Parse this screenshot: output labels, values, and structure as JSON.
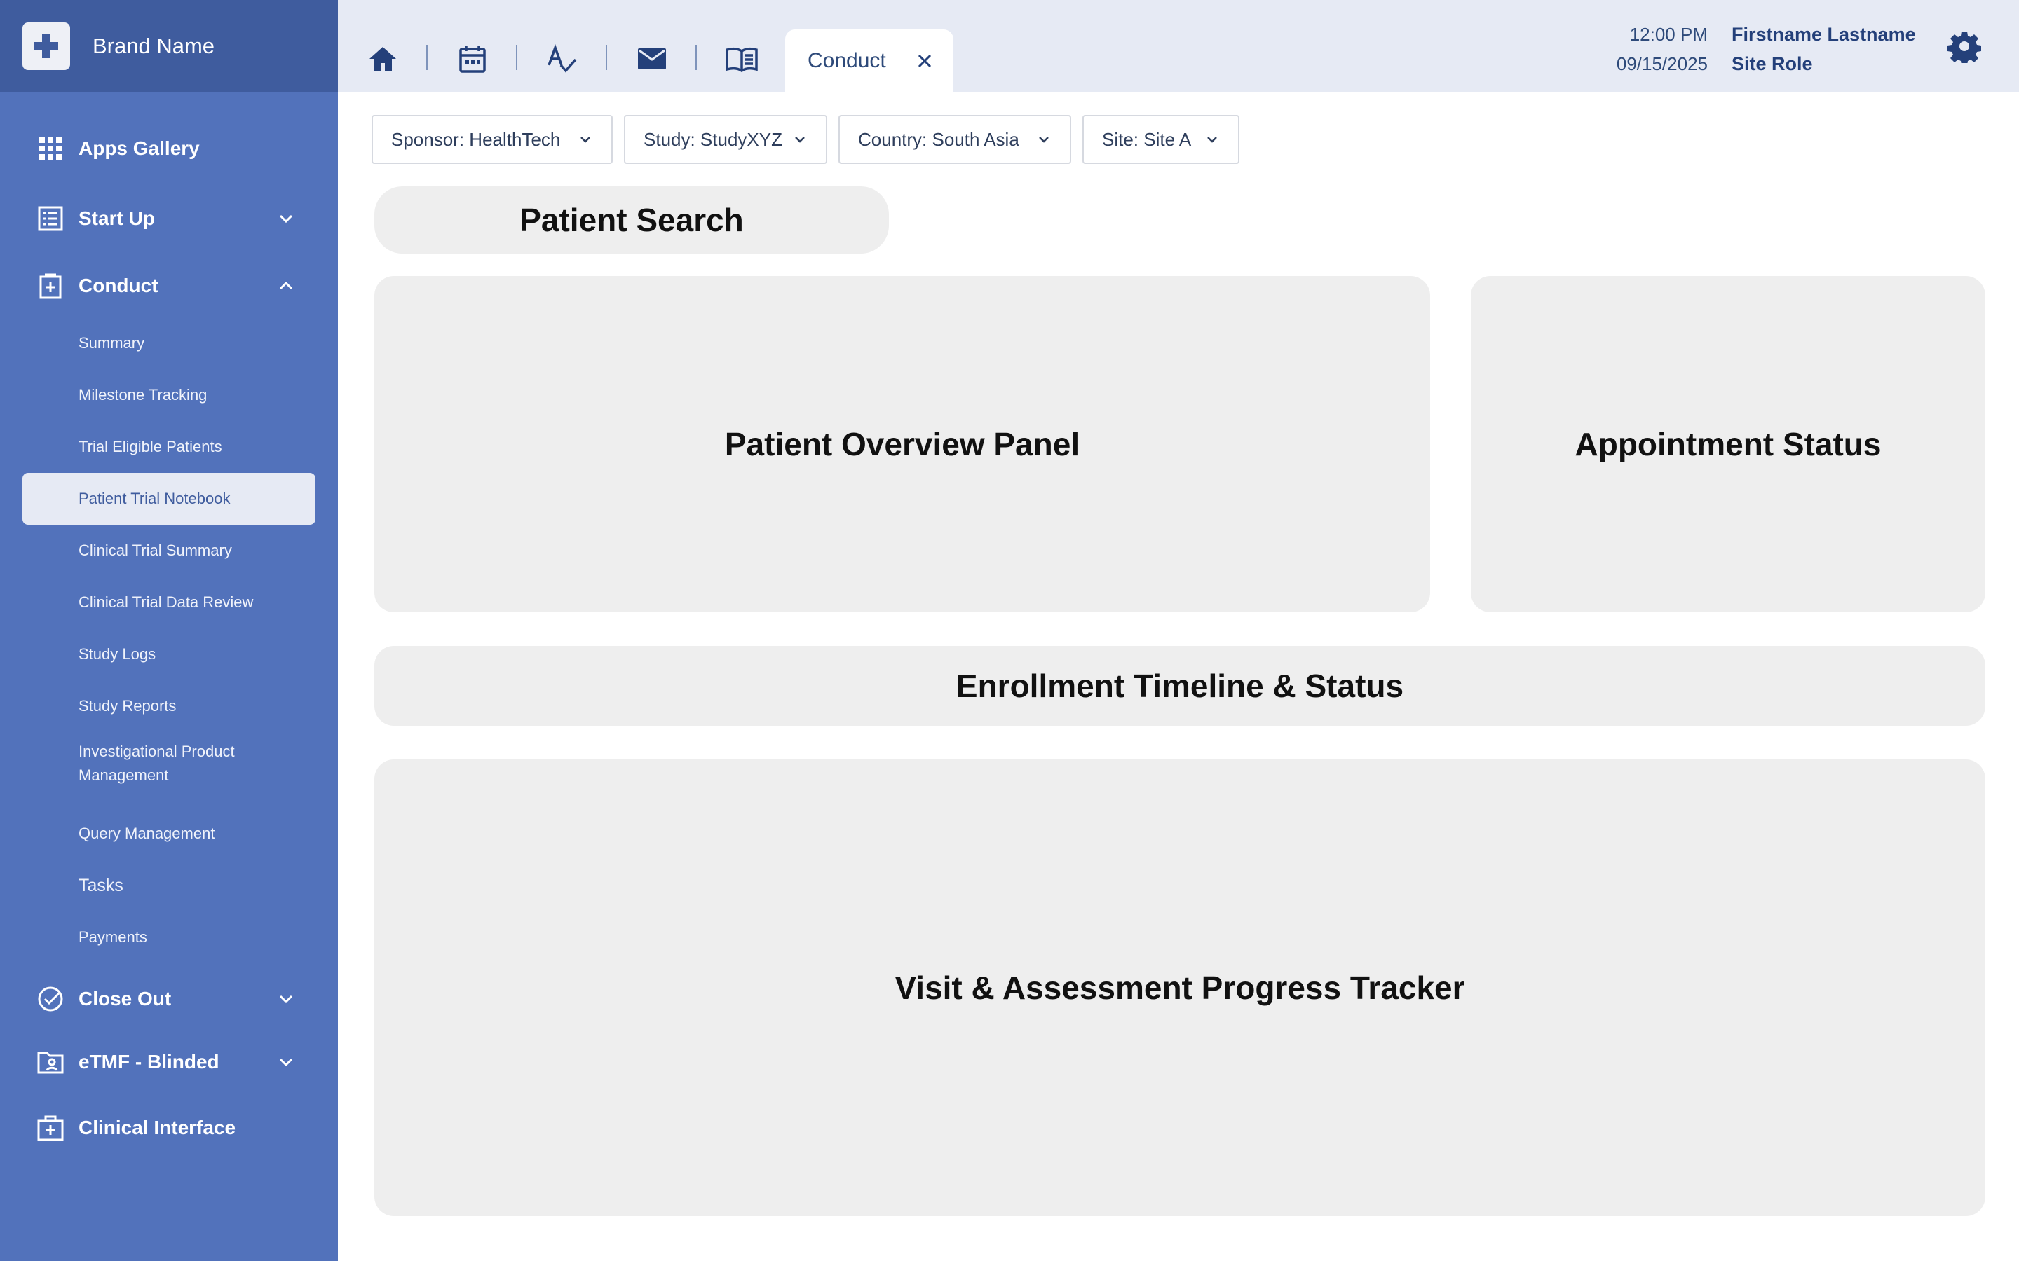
{
  "brand": {
    "name": "Brand Name",
    "icon": "medical-cross-icon"
  },
  "sidebar": {
    "items": [
      {
        "label": "Apps Gallery",
        "icon": "grid-icon"
      },
      {
        "label": "Start Up",
        "icon": "checklist-icon",
        "expanded": false
      },
      {
        "label": "Conduct",
        "icon": "clipboard-plus-icon",
        "expanded": true
      },
      {
        "label": "Close Out",
        "icon": "check-circle-icon",
        "expanded": false
      },
      {
        "label": "eTMF - Blinded",
        "icon": "folder-user-icon",
        "expanded": false
      },
      {
        "label": "Clinical Interface",
        "icon": "medical-bag-icon"
      }
    ],
    "conduct_sub": [
      "Summary",
      "Milestone Tracking",
      "Trial Eligible Patients",
      "Patient Trial Notebook",
      "Clinical Trial Summary",
      "Clinical Trial Data Review",
      "Study Logs",
      "Study Reports",
      "Investigational Product Management",
      "Query Management",
      "Tasks",
      "Payments"
    ],
    "active_sub": "Patient Trial Notebook"
  },
  "topbar": {
    "icons": [
      "home-icon",
      "calendar-icon",
      "spellcheck-icon",
      "mail-icon",
      "book-icon"
    ],
    "tab": {
      "label": "Conduct"
    },
    "time": "12:00 PM",
    "date": "09/15/2025",
    "user_name": "Firstname Lastname",
    "user_role": "Site Role"
  },
  "filters": [
    "Sponsor: HealthTech",
    "Study: StudyXYZ",
    "Country: South Asia",
    "Site: Site A"
  ],
  "panels": {
    "search": "Patient Search",
    "overview": "Patient Overview Panel",
    "appointment": "Appointment Status",
    "enrollment": "Enrollment Timeline & Status",
    "visit": "Visit & Assessment Progress Tracker"
  },
  "colors": {
    "sidebar": "#5272bb",
    "brand_bar": "#3f5c9e",
    "topbar": "#e6eaf4",
    "panel": "#eeeeee",
    "accent_text": "#24407a"
  }
}
